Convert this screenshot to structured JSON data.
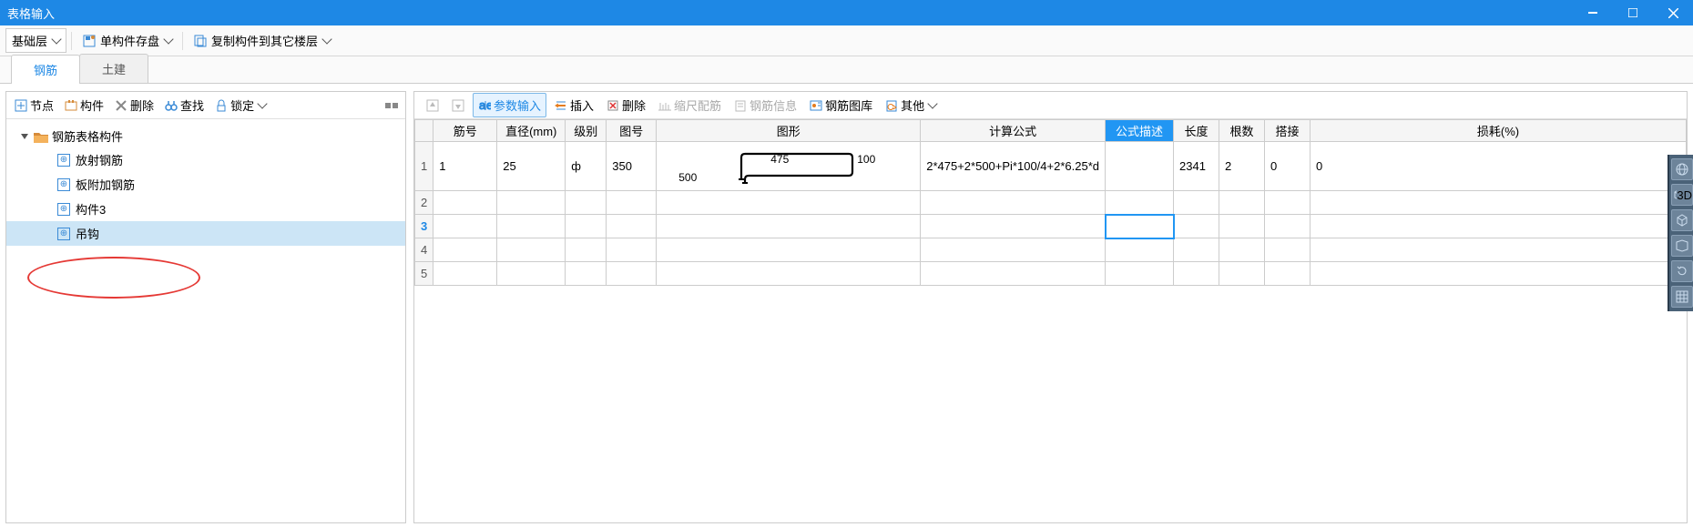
{
  "titlebar": {
    "title": "表格输入"
  },
  "toolbar_top": {
    "layer_dropdown": "基础层",
    "save_component": "单构件存盘",
    "copy_component": "复制构件到其它楼层"
  },
  "tabs": {
    "rebar": "钢筋",
    "civil": "土建"
  },
  "left_toolbar": {
    "node": "节点",
    "component": "构件",
    "delete": "删除",
    "find": "查找",
    "lock": "锁定"
  },
  "tree": {
    "root": "钢筋表格构件",
    "items": [
      {
        "label": "放射钢筋"
      },
      {
        "label": "板附加钢筋"
      },
      {
        "label": "构件3"
      },
      {
        "label": "吊钩"
      }
    ]
  },
  "right_toolbar": {
    "param_input": "参数输入",
    "insert": "插入",
    "delete": "删除",
    "scale": "缩尺配筋",
    "info": "钢筋信息",
    "library": "钢筋图库",
    "other": "其他"
  },
  "grid": {
    "headers": [
      "筋号",
      "直径(mm)",
      "级别",
      "图号",
      "图形",
      "计算公式",
      "公式描述",
      "长度",
      "根数",
      "搭接",
      "损耗(%)"
    ],
    "rows": [
      {
        "num": "1",
        "dia": "25",
        "grade": "ф",
        "shape_no": "350",
        "shape_dims": {
          "a": "500",
          "b": "475",
          "c": "100"
        },
        "formula": "2*475+2*500+Pi*100/4+2*6.25*d",
        "desc": "",
        "len": "2341",
        "qty": "2",
        "splice": "0",
        "loss": "0"
      },
      {},
      {},
      {},
      {}
    ],
    "selected_row": 3,
    "selected_col": 6
  }
}
